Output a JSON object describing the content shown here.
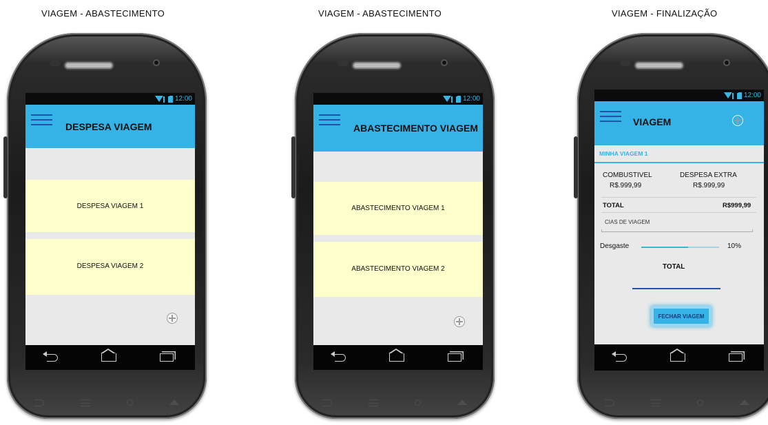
{
  "captions": [
    "VIAGEM - ABASTECIMENTO",
    "VIAGEM - ABASTECIMENTO",
    "VIAGEM - FINALIZAÇÃO"
  ],
  "status": {
    "time": "12:00"
  },
  "screen1": {
    "title": "DESPESA VIAGEM",
    "cards": [
      "DESPESA VIAGEM 1",
      "DESPESA VIAGEM 2"
    ]
  },
  "screen2": {
    "title": "ABASTECIMENTO VIAGEM",
    "cards": [
      "ABASTECIMENTO VIAGEM 1",
      "ABASTECIMENTO VIAGEM 2"
    ]
  },
  "screen3": {
    "title": "VIAGEM",
    "trip_name": "MINHA VIAGEM 1",
    "combustivel_label": "COMBUSTIVEL",
    "combustivel_value": "R$.999,99",
    "despesa_label": "DESPESA EXTRA",
    "despesa_value": "R$.999,99",
    "total_label": "TOTAL",
    "total_value": "R$999,99",
    "days_placeholder": "CIAS DE VIAGEM",
    "desgaste_label": "Desgaste",
    "desgaste_value": "10%",
    "desgaste_level": 0.6,
    "total_heading": "TOTAL",
    "close_button": "FECHAR VIAGEM"
  },
  "colors": {
    "appbar": "#35b2e6",
    "card": "#ffffcc",
    "hamburger": "#2350a8"
  },
  "icons": [
    "menu-icon",
    "add-icon",
    "wifi-signal-icon",
    "battery-icon",
    "back-icon",
    "home-icon",
    "recent-apps-icon"
  ]
}
